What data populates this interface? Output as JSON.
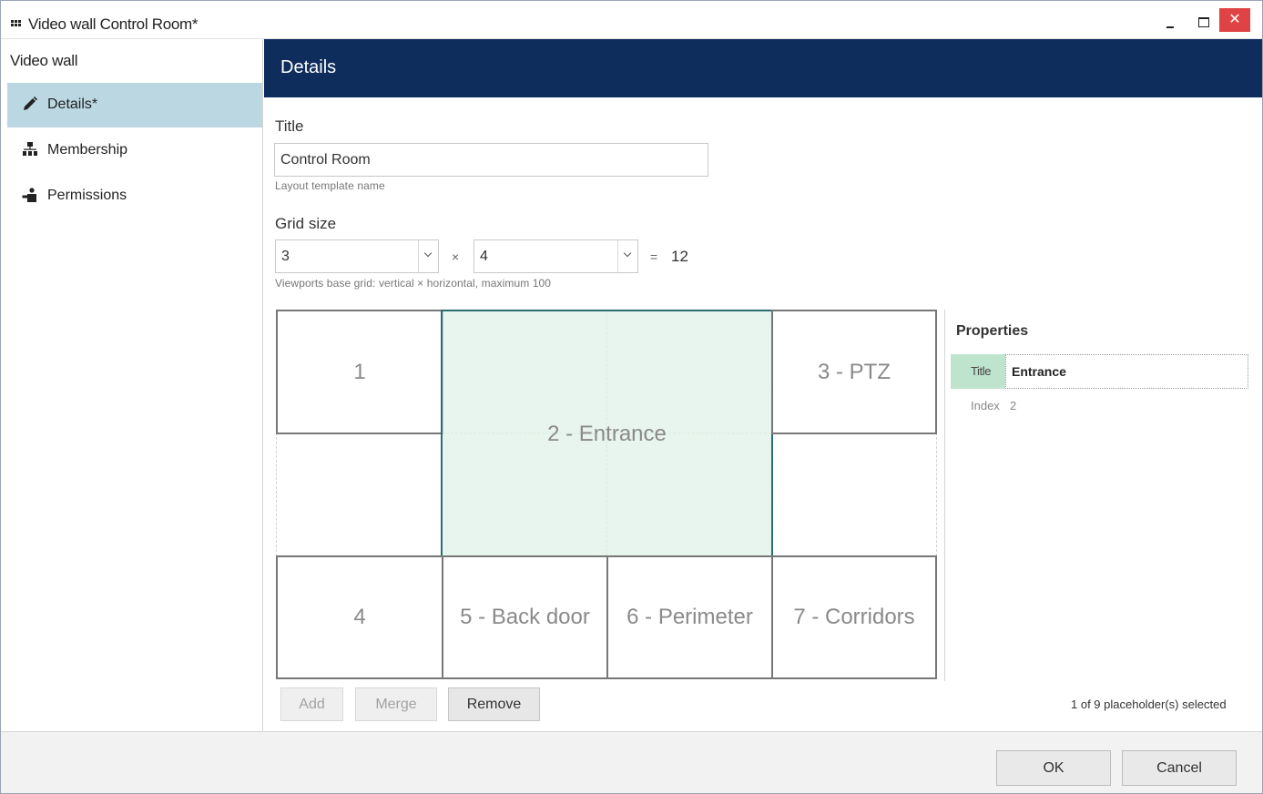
{
  "window": {
    "title": "Video wall Control Room*",
    "close_glyph": "✕"
  },
  "sidebar": {
    "title": "Video wall",
    "items": [
      {
        "label": "Details*",
        "icon": "pencil-icon",
        "active": true
      },
      {
        "label": "Membership",
        "icon": "hierarchy-icon",
        "active": false
      },
      {
        "label": "Permissions",
        "icon": "access-icon",
        "active": false
      }
    ]
  },
  "header": {
    "title": "Details"
  },
  "form": {
    "title_label": "Title",
    "title_value": "Control Room",
    "title_hint": "Layout template name",
    "grid_label": "Grid size",
    "grid_vertical": "3",
    "grid_times": "×",
    "grid_horizontal": "4",
    "grid_equals": "=",
    "grid_total": "12",
    "grid_hint": "Viewports base grid: vertical × horizontal, maximum 100"
  },
  "viewports": [
    {
      "label": "1",
      "selected": false
    },
    {
      "label": "2 - Entrance",
      "selected": true
    },
    {
      "label": "3 - PTZ",
      "selected": false
    },
    {
      "label": "4",
      "selected": false
    },
    {
      "label": "5 - Back door",
      "selected": false
    },
    {
      "label": "6 - Perimeter",
      "selected": false
    },
    {
      "label": "7 - Corridors",
      "selected": false
    }
  ],
  "properties": {
    "heading": "Properties",
    "title_key": "Title",
    "title_value": "Entrance",
    "index_key": "Index",
    "index_value": "2"
  },
  "actions": {
    "add": "Add",
    "merge": "Merge",
    "remove": "Remove",
    "selection_status": "1 of 9 placeholder(s) selected"
  },
  "footer": {
    "ok": "OK",
    "cancel": "Cancel"
  },
  "colors": {
    "header_bg": "#0e2c5c",
    "active_nav": "#bad7e2",
    "selected_viewport": "#e0f2e8",
    "property_key": "#bfe4cd",
    "close_button": "#e04343"
  }
}
